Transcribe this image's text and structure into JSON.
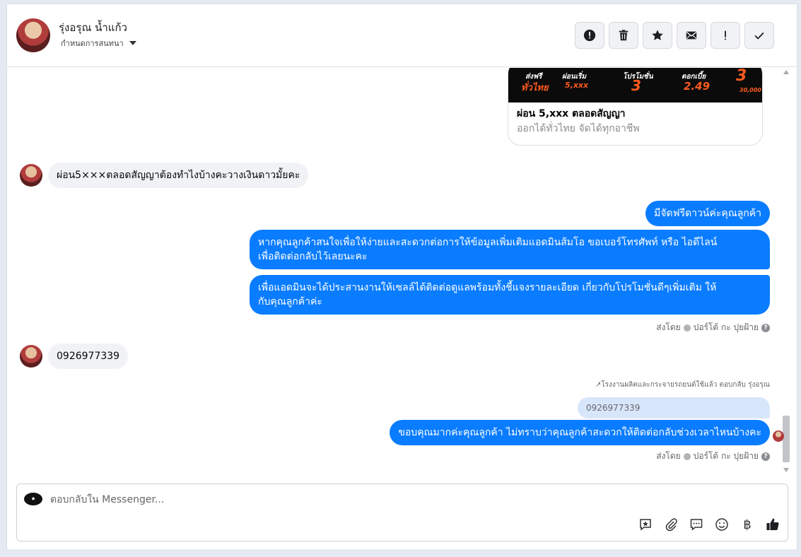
{
  "header": {
    "contact_name": "รุ่งอรุณ น้ำแก้ว",
    "assign_label": "กำหนดการสนทนา",
    "actions": [
      {
        "name": "report-spam-button",
        "icon": "alert-circle-icon"
      },
      {
        "name": "delete-button",
        "icon": "trash-icon"
      },
      {
        "name": "star-button",
        "icon": "star-icon"
      },
      {
        "name": "mark-unread-button",
        "icon": "envelope-icon"
      },
      {
        "name": "follow-up-button",
        "icon": "exclamation-icon"
      },
      {
        "name": "mark-done-button",
        "icon": "check-icon"
      }
    ]
  },
  "card": {
    "promo1": "ส่งฟรี",
    "promo1_val": "ทั่วไทย",
    "promo2": "ผ่อนเริ่ม",
    "promo2_val": "5,xxx",
    "promo3": "โปรโมชั่น",
    "promo3_val": "3",
    "promo4": "ดอกเบี้ย",
    "promo4_val": "2.49",
    "promo5_val": "3",
    "promo5_sub": "30,000",
    "title": "ผ่อน 5,xxx ตลอดสัญญา",
    "subtitle": "ออกได้ทั่วไทย จัดได้ทุกอาชีพ"
  },
  "messages": {
    "in1": "ผ่อน5×××ตลอดสัญญาต้องทำไงบ้างคะวางเงินดาวมั้ยคะ",
    "out1": "มีจัดฟรีดาวน์ค่ะคุณลูกค้า",
    "out2_line1": "หากคุณลูกค้าสนใจเพื่อให้ง่ายและสะดวกต่อการให้ข้อมูลเพิ่มเติมแอดมินส้มโอ ขอเบอร์โทรศัพท์ หรือ ไอดีไลน์",
    "out2_line2": "เพื่อติดต่อกลับไว้เลยนะคะ",
    "out3_line1": "เพื่อแอดมินจะได้ประสานงานให้เซลล์ได้ติดต่อดูแลพร้อมทั้งชี้แจงรายละเอียด เกี่ยวกับโปรโมชั่นดีๆเพิ่มเติม ให้",
    "out3_line2": "กับคุณลูกค้าค่ะ",
    "sent_by1": "ส่งโดย",
    "sender1": "ปอร์โต้ กะ ปุยฝ้าย",
    "in2": "0926977339",
    "reply_note": "โรงงานผลิตและกระจายรถยนต์ใช้แล้ว ตอบกลับ รุ่งอรุณ",
    "quoted": "0926977339",
    "out4": "ขอบคุณมากค่ะคุณลูกค้า ไม่ทราบว่าคุณลูกค้าสะดวกให้ติดต่อกลับช่วงเวลาไหนบ้างคะ",
    "sent_by2": "ส่งโดย",
    "sender2": "ปอร์โต้ กะ ปุยฝ้าย"
  },
  "composer": {
    "placeholder": "ตอบกลับใน Messenger...",
    "tools": [
      "saved-reply-icon",
      "attachment-icon",
      "message-icon",
      "emoji-icon",
      "baht-icon",
      "like-icon"
    ],
    "baht_symbol": "฿"
  },
  "colors": {
    "outgoing": "#0a7cff",
    "incoming": "#f0f2f5",
    "quoted": "#d8e6fb"
  }
}
